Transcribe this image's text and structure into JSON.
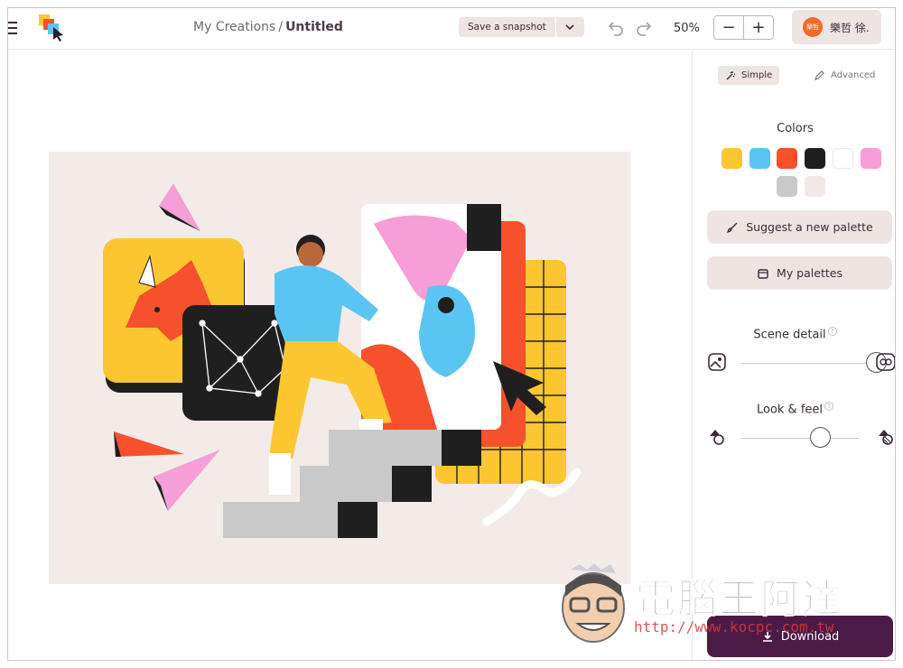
{
  "header": {
    "breadcrumb_parent": "My Creations",
    "breadcrumb_separator": "/",
    "breadcrumb_current": "Untitled",
    "snapshot_label": "Save a snapshot",
    "zoom_level": "50%",
    "zoom_out": "−",
    "zoom_in": "+",
    "user_avatar_text": "樂哲",
    "user_name": "樂哲 徐."
  },
  "panel": {
    "modes": {
      "simple": "Simple",
      "advanced": "Advanced"
    },
    "colors_title": "Colors",
    "palette": [
      "#fcc630",
      "#5bc5f2",
      "#f4512c",
      "#1f1f1f",
      "#ffffff",
      "#f59fd6",
      "#c9c9c9",
      "#f3e8e8"
    ],
    "suggest_label": "Suggest a new palette",
    "my_palettes_label": "My palettes",
    "scene_detail": {
      "label": "Scene detail",
      "help": "?",
      "value": 1.0
    },
    "look_feel": {
      "label": "Look & feel",
      "help": "?",
      "value": 0.68
    },
    "download_label": "Download"
  },
  "watermark": {
    "title": "電腦王阿達",
    "url": "http://www.kocpc.com.tw"
  },
  "icons": {
    "menu": "hamburger-icon",
    "undo": "undo-icon",
    "redo": "redo-icon",
    "dropdown": "chevron-down-icon",
    "simple": "magic-wand-icon",
    "advanced": "pencil-icon",
    "suggest": "brush-icon",
    "palettes": "folder-icon",
    "download": "download-icon"
  }
}
